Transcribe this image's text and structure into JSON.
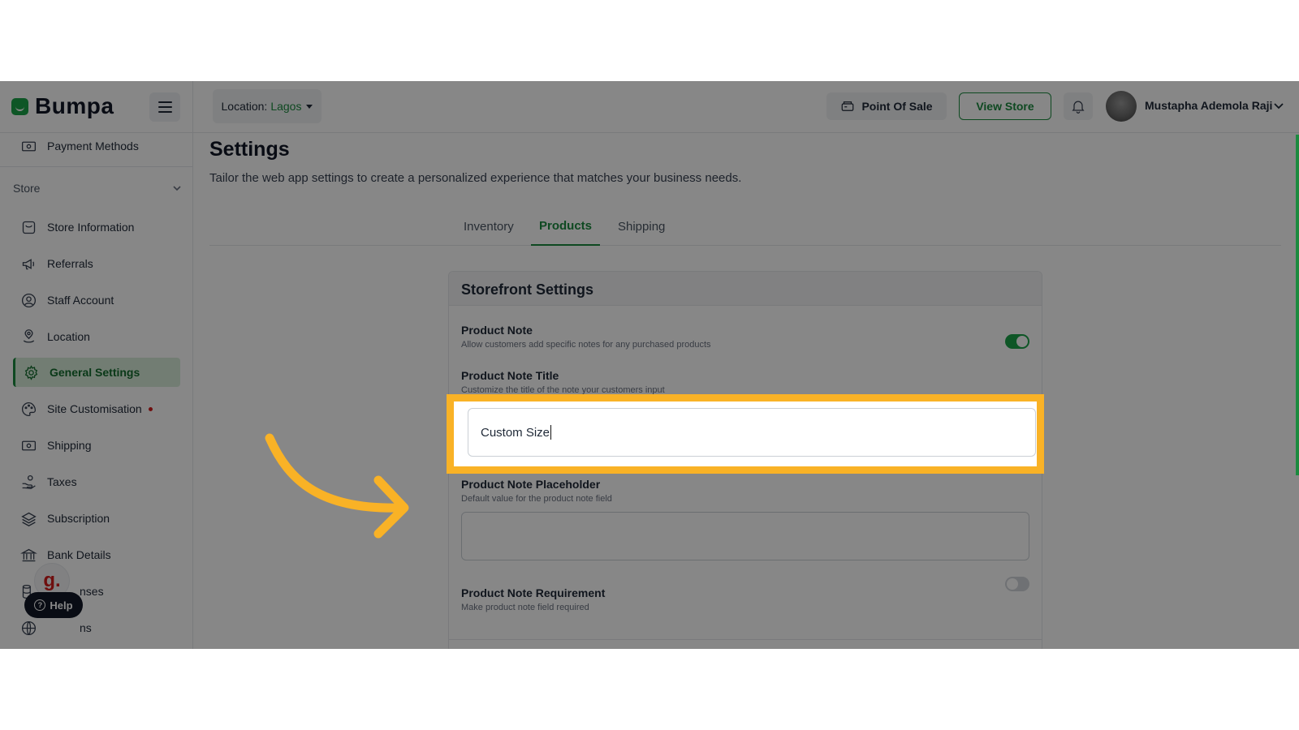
{
  "brand": {
    "name": "Bumpa"
  },
  "sidebar": {
    "top_item": "Payment Methods",
    "section_label": "Store",
    "items": [
      {
        "label": "Store Information",
        "icon": "store-icon"
      },
      {
        "label": "Referrals",
        "icon": "megaphone-icon"
      },
      {
        "label": "Staff Account",
        "icon": "user-circle-icon"
      },
      {
        "label": "Location",
        "icon": "location-pin-icon"
      },
      {
        "label": "General Settings",
        "icon": "gear-icon",
        "active": true
      },
      {
        "label": "Site Customisation",
        "icon": "palette-icon",
        "dot": true
      },
      {
        "label": "Shipping",
        "icon": "money-icon"
      },
      {
        "label": "Taxes",
        "icon": "hand-coins-icon"
      },
      {
        "label": "Subscription",
        "icon": "layers-icon"
      },
      {
        "label": "Bank Details",
        "icon": "bank-icon"
      },
      {
        "label": "nses",
        "icon": "database-icon"
      },
      {
        "label": "ns",
        "icon": "globe-icon"
      }
    ],
    "badge_letter": "g.",
    "help_label": "Help"
  },
  "header": {
    "location_prefix": "Location: ",
    "location_value": "Lagos",
    "pos_label": "Point Of Sale",
    "view_store_label": "View Store",
    "user_name": "Mustapha Ademola Raji"
  },
  "main": {
    "title": "Settings",
    "subtitle": "Tailor the web app settings to create a personalized experience that matches your business needs.",
    "tabs": [
      {
        "label": "Inventory"
      },
      {
        "label": "Products",
        "active": true
      },
      {
        "label": "Shipping"
      }
    ]
  },
  "card": {
    "title": "Storefront Settings",
    "product_note": {
      "label": "Product Note",
      "help": "Allow customers add specific notes for any purchased products",
      "enabled": true
    },
    "note_title": {
      "label": "Product Note Title",
      "help": "Customize the title of the note your customers input",
      "value": "Custom Size"
    },
    "note_placeholder": {
      "label": "Product Note Placeholder",
      "help": "Default value for the product note field",
      "value": ""
    },
    "note_requirement": {
      "label": "Product Note Requirement",
      "help": "Make product note field required",
      "enabled": false
    }
  },
  "colors": {
    "accent": "#1c8a3f",
    "highlight": "#f9b226",
    "toggle_on": "#1ca249"
  }
}
